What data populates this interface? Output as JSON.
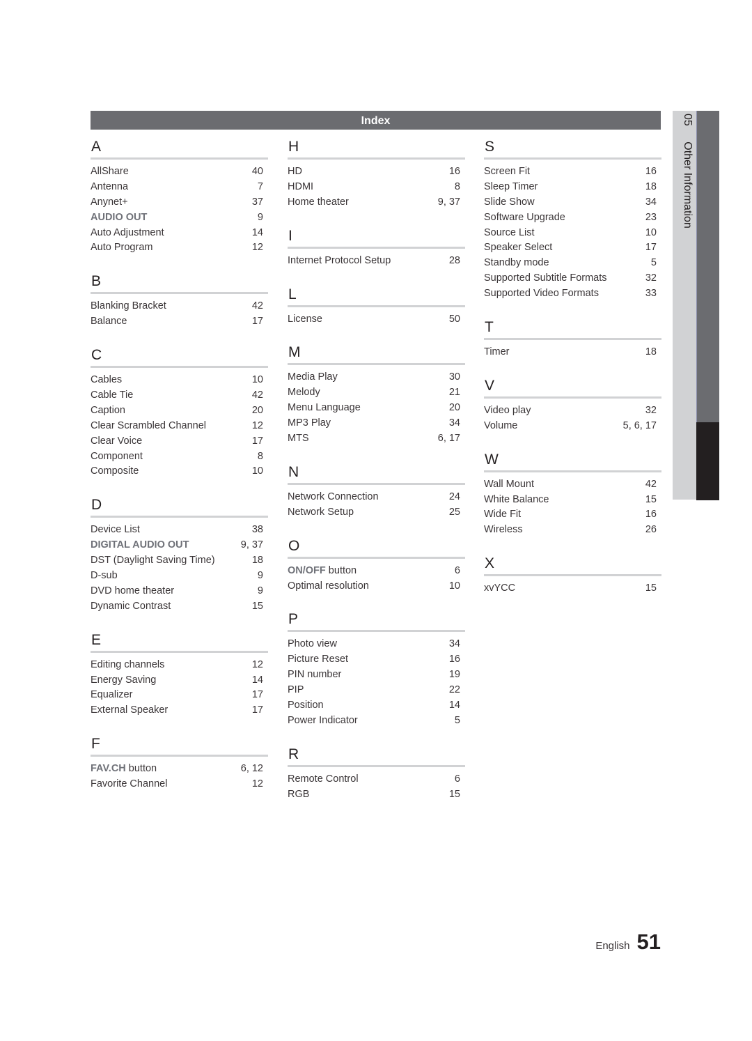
{
  "header": {
    "title": "Index"
  },
  "side_tab": {
    "chapter_number": "05",
    "chapter_title": "Other Information"
  },
  "footer": {
    "language": "English",
    "page_number": "51"
  },
  "colors": {
    "highlight_text": "#6f7178",
    "header_bar": "#6b6c70",
    "rule": "#d1d2d4"
  },
  "columns": [
    {
      "sections": [
        {
          "letter": "A",
          "entries": [
            {
              "term": "AllShare",
              "page": "40"
            },
            {
              "term": "Antenna",
              "page": "7"
            },
            {
              "term": "Anynet+",
              "page": "37"
            },
            {
              "term_highlight": "AUDIO OUT",
              "term": "",
              "page": "9"
            },
            {
              "term": "Auto Adjustment",
              "page": "14"
            },
            {
              "term": "Auto Program",
              "page": "12"
            }
          ]
        },
        {
          "letter": "B",
          "entries": [
            {
              "term": "Blanking Bracket",
              "page": "42"
            },
            {
              "term": "Balance",
              "page": "17"
            }
          ]
        },
        {
          "letter": "C",
          "entries": [
            {
              "term": "Cables",
              "page": "10"
            },
            {
              "term": "Cable Tie",
              "page": "42"
            },
            {
              "term": "Caption",
              "page": "20"
            },
            {
              "term": "Clear Scrambled Channel",
              "page": "12"
            },
            {
              "term": "Clear Voice",
              "page": "17"
            },
            {
              "term": "Component",
              "page": "8"
            },
            {
              "term": "Composite",
              "page": "10"
            }
          ]
        },
        {
          "letter": "D",
          "entries": [
            {
              "term": "Device List",
              "page": "38"
            },
            {
              "term_highlight": "DIGITAL AUDIO OUT",
              "term": "",
              "page": "9, 37"
            },
            {
              "term": "DST (Daylight Saving Time)",
              "page": "18"
            },
            {
              "term": "D-sub",
              "page": "9"
            },
            {
              "term": "DVD home theater",
              "page": "9"
            },
            {
              "term": "Dynamic Contrast",
              "page": "15"
            }
          ]
        },
        {
          "letter": "E",
          "entries": [
            {
              "term": "Editing channels",
              "page": "12"
            },
            {
              "term": "Energy Saving",
              "page": "14"
            },
            {
              "term": "Equalizer",
              "page": "17"
            },
            {
              "term": "External Speaker",
              "page": "17"
            }
          ]
        },
        {
          "letter": "F",
          "entries": [
            {
              "term_highlight": "FAV.CH",
              "term": " button",
              "page": "6, 12"
            },
            {
              "term": "Favorite Channel",
              "page": "12"
            }
          ]
        }
      ]
    },
    {
      "sections": [
        {
          "letter": "H",
          "entries": [
            {
              "term": "HD",
              "page": "16"
            },
            {
              "term": "HDMI",
              "page": "8"
            },
            {
              "term": "Home theater",
              "page": "9, 37"
            }
          ]
        },
        {
          "letter": "I",
          "entries": [
            {
              "term": "Internet Protocol Setup",
              "page": "28"
            }
          ]
        },
        {
          "letter": "L",
          "entries": [
            {
              "term": "License",
              "page": "50"
            }
          ]
        },
        {
          "letter": "M",
          "entries": [
            {
              "term": "Media Play",
              "page": "30"
            },
            {
              "term": "Melody",
              "page": "21"
            },
            {
              "term": "Menu Language",
              "page": "20"
            },
            {
              "term": "MP3 Play",
              "page": "34"
            },
            {
              "term": "MTS",
              "page": "6, 17"
            }
          ]
        },
        {
          "letter": "N",
          "entries": [
            {
              "term": "Network Connection",
              "page": "24"
            },
            {
              "term": "Network Setup",
              "page": "25"
            }
          ]
        },
        {
          "letter": "O",
          "entries": [
            {
              "term_highlight": "ON/OFF",
              "term": " button",
              "page": "6"
            },
            {
              "term": "Optimal resolution",
              "page": "10"
            }
          ]
        },
        {
          "letter": "P",
          "entries": [
            {
              "term": "Photo view",
              "page": "34"
            },
            {
              "term": "Picture Reset",
              "page": "16"
            },
            {
              "term": "PIN number",
              "page": "19"
            },
            {
              "term": "PIP",
              "page": "22"
            },
            {
              "term": "Position",
              "page": "14"
            },
            {
              "term": "Power Indicator",
              "page": "5"
            }
          ]
        },
        {
          "letter": "R",
          "entries": [
            {
              "term": "Remote Control",
              "page": "6"
            },
            {
              "term": "RGB",
              "page": "15"
            }
          ]
        }
      ]
    },
    {
      "sections": [
        {
          "letter": "S",
          "entries": [
            {
              "term": "Screen Fit",
              "page": "16"
            },
            {
              "term": "Sleep Timer",
              "page": "18"
            },
            {
              "term": "Slide Show",
              "page": "34"
            },
            {
              "term": "Software Upgrade",
              "page": "23"
            },
            {
              "term": "Source List",
              "page": "10"
            },
            {
              "term": "Speaker Select",
              "page": "17"
            },
            {
              "term": "Standby mode",
              "page": "5"
            },
            {
              "term": "Supported Subtitle Formats",
              "page": "32"
            },
            {
              "term": "Supported Video Formats",
              "page": "33"
            }
          ]
        },
        {
          "letter": "T",
          "entries": [
            {
              "term": "Timer",
              "page": "18"
            }
          ]
        },
        {
          "letter": "V",
          "entries": [
            {
              "term": "Video play",
              "page": "32"
            },
            {
              "term": "Volume",
              "page": "5, 6, 17"
            }
          ]
        },
        {
          "letter": "W",
          "entries": [
            {
              "term": "Wall Mount",
              "page": "42"
            },
            {
              "term": "White Balance",
              "page": "15"
            },
            {
              "term": "Wide Fit",
              "page": "16"
            },
            {
              "term": "Wireless",
              "page": "26"
            }
          ]
        },
        {
          "letter": "X",
          "entries": [
            {
              "term": "xvYCC",
              "page": "15"
            }
          ]
        }
      ]
    }
  ]
}
